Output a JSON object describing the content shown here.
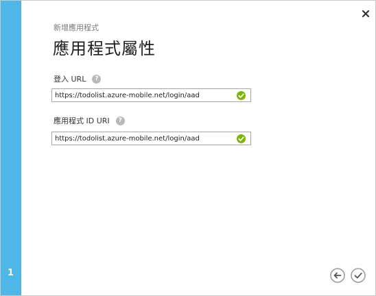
{
  "wizard": {
    "step_number": "1",
    "subtitle": "新增應用程式",
    "title": "應用程式屬性"
  },
  "fields": [
    {
      "label": "登入 URL",
      "value": "https://todolist.azure-mobile.net/login/aad",
      "valid": true
    },
    {
      "label": "應用程式 ID URI",
      "value": "https://todolist.azure-mobile.net/login/aad",
      "valid": true
    }
  ],
  "help_glyph": "?",
  "icons": {
    "close": "close-icon",
    "help": "help-icon",
    "valid": "checkmark-circle-icon",
    "back": "back-arrow-icon",
    "complete": "checkmark-icon"
  },
  "colors": {
    "rail": "#4db8e8",
    "valid": "#7ab800",
    "help": "#b9b9b9",
    "nav_button": "#9a9a9a"
  }
}
